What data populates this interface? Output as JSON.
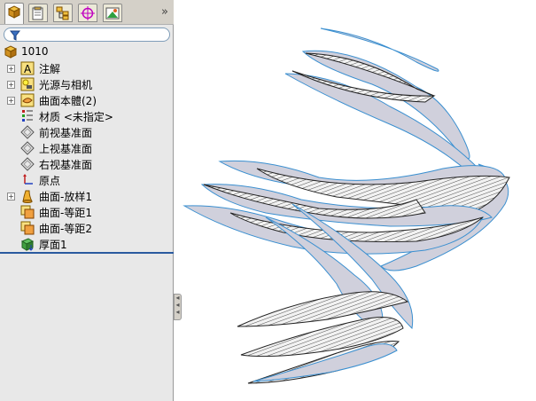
{
  "feature_manager": {
    "tabs": [
      {
        "name": "feature-manager-tab",
        "icon": "feature-tree-icon"
      },
      {
        "name": "property-manager-tab",
        "icon": "property-manager-icon"
      },
      {
        "name": "configuration-manager-tab",
        "icon": "configuration-manager-icon"
      },
      {
        "name": "dimxpert-manager-tab",
        "icon": "crosshair-icon"
      },
      {
        "name": "display-manager-tab",
        "icon": "display-manager-icon"
      }
    ],
    "more_label": "»",
    "tree": [
      {
        "label": "1010",
        "icon": "part-icon",
        "expander": false,
        "indent": 0
      },
      {
        "label": "注解",
        "icon": "annotation-icon",
        "expander": true,
        "indent": 1
      },
      {
        "label": "光源与相机",
        "icon": "lights-camera-icon",
        "expander": true,
        "indent": 1
      },
      {
        "label": "曲面本體(2)",
        "icon": "surface-bodies-icon",
        "expander": true,
        "indent": 1
      },
      {
        "label": "材质 <未指定>",
        "icon": "material-icon",
        "expander": false,
        "indent": 1
      },
      {
        "label": "前视基准面",
        "icon": "plane-icon",
        "expander": false,
        "indent": 1
      },
      {
        "label": "上视基准面",
        "icon": "plane-icon",
        "expander": false,
        "indent": 1
      },
      {
        "label": "右视基准面",
        "icon": "plane-icon",
        "expander": false,
        "indent": 1
      },
      {
        "label": "原点",
        "icon": "origin-icon",
        "expander": false,
        "indent": 1
      },
      {
        "label": "曲面-放样1",
        "icon": "surface-loft-icon",
        "expander": true,
        "indent": 1
      },
      {
        "label": "曲面-等距1",
        "icon": "surface-offset-icon",
        "expander": false,
        "indent": 1
      },
      {
        "label": "曲面-等距2",
        "icon": "surface-offset-icon",
        "expander": false,
        "indent": 1
      },
      {
        "label": "厚面1",
        "icon": "thicken-icon",
        "expander": false,
        "indent": 1
      }
    ]
  },
  "colors": {
    "panel_bg": "#e8e8e8",
    "surface_fill": "#d0d0dc",
    "surface_edge": "#3a8fd0",
    "rollback_bar": "#2a5a9e"
  }
}
